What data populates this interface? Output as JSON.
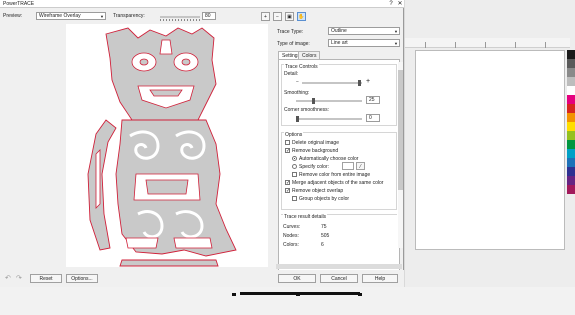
{
  "dialog": {
    "title": "PowerTRACE",
    "win_minimize": "–",
    "win_close": "✕"
  },
  "toolbar": {
    "preview_label": "Preview:",
    "preview_mode": "Wireframe Overlay",
    "transparency_label": "Transparency:",
    "transparency_value": "80",
    "tools": [
      "zoom-in-icon",
      "zoom-out-icon",
      "fit-page-icon",
      "pan-hand-icon"
    ]
  },
  "panel": {
    "trace_type_label": "Trace Type:",
    "trace_type_value": "Outline",
    "image_type_label": "Type of image:",
    "image_type_value": "Line art",
    "tabs": [
      {
        "label": "Settings"
      },
      {
        "label": "Colors"
      }
    ],
    "trace_controls_title": "Trace Controls",
    "detail_label": "Detail:",
    "smoothing_label": "Smoothing:",
    "smoothing_value": "25",
    "corner_label": "Corner smoothness:",
    "corner_value": "0",
    "options_title": "Options",
    "delete_original": "Delete original image",
    "remove_background": "Remove background",
    "auto_choose_color": "Automatically choose color",
    "specify_color": "Specify color:",
    "remove_color_entire": "Remove color from entire image",
    "merge_adjacent": "Merge adjacent objects of the same color",
    "remove_overlap": "Remove object overlap",
    "group_by_color": "Group objects by color",
    "results_title": "Trace result details",
    "results": [
      {
        "label": "Curves:",
        "value": "75"
      },
      {
        "label": "Nodes:",
        "value": "505"
      },
      {
        "label": "Colors:",
        "value": "6"
      }
    ]
  },
  "footer": {
    "undo_icon": "undo-icon",
    "redo_icon": "redo-icon",
    "reset": "Reset",
    "options": "Options...",
    "ok": "OK",
    "cancel": "Cancel",
    "help": "Help"
  },
  "colors": {
    "trace_fill": "#c9c9c9",
    "trace_outline": "#d0213a",
    "palette": [
      "#1a1a1a",
      "#5a5a5a",
      "#8a8a8a",
      "#bdbdbd",
      "#ffffff",
      "#e5007e",
      "#d7261e",
      "#f39200",
      "#ffde00",
      "#95c11f",
      "#009640",
      "#00a0c6",
      "#1d71b8",
      "#2e3192",
      "#662483",
      "#a2195b"
    ]
  }
}
